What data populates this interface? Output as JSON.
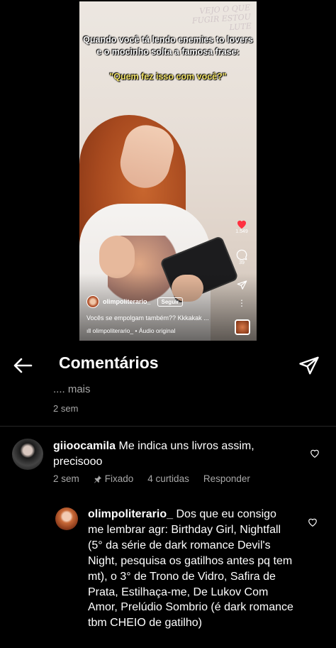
{
  "reel": {
    "caption_line1": "Quando você tá lendo enemies to lovers",
    "caption_line2": "e o mocinho solta a famosa frase:",
    "quote": "\"Quem fez isso com você?\"",
    "wall_text": "VEJO O QUE FUGIR ESTOU LUTE",
    "like_count": "1.549",
    "comment_count": "39",
    "username": "olimpoliterario_",
    "follow_label": "Seguir",
    "description": "Vocês se empolgam também?? Kkkakak ...",
    "audio": "olimpoliterario_ • Áudio original"
  },
  "header": {
    "title": "Comentários"
  },
  "previous": {
    "more_label": ".... mais",
    "age": "2 sem"
  },
  "comments": [
    {
      "username": "giioocamila",
      "text": "Me indica uns livros assim, precisooo",
      "age": "2 sem",
      "pinned_label": "Fixado",
      "likes": "4 curtidas",
      "reply_label": "Responder"
    }
  ],
  "reply": {
    "username": "olimpoliterario_",
    "text": "Dos que eu consigo me lembrar agr: Birthday Girl, Nightfall (5° da série de dark romance Devil's Night, pesquisa os gatilhos antes pq tem mt), o 3° de Trono de Vidro, Safira de Prata, Estilhaça-me, De Lukov Com Amor, Prelúdio Sombrio (é dark romance tbm CHEIO de gatilho)"
  },
  "colors": {
    "background": "#000000",
    "secondary_text": "#a8a8a8",
    "like_red": "#ff3040",
    "quote_yellow": "#f2e36a"
  }
}
